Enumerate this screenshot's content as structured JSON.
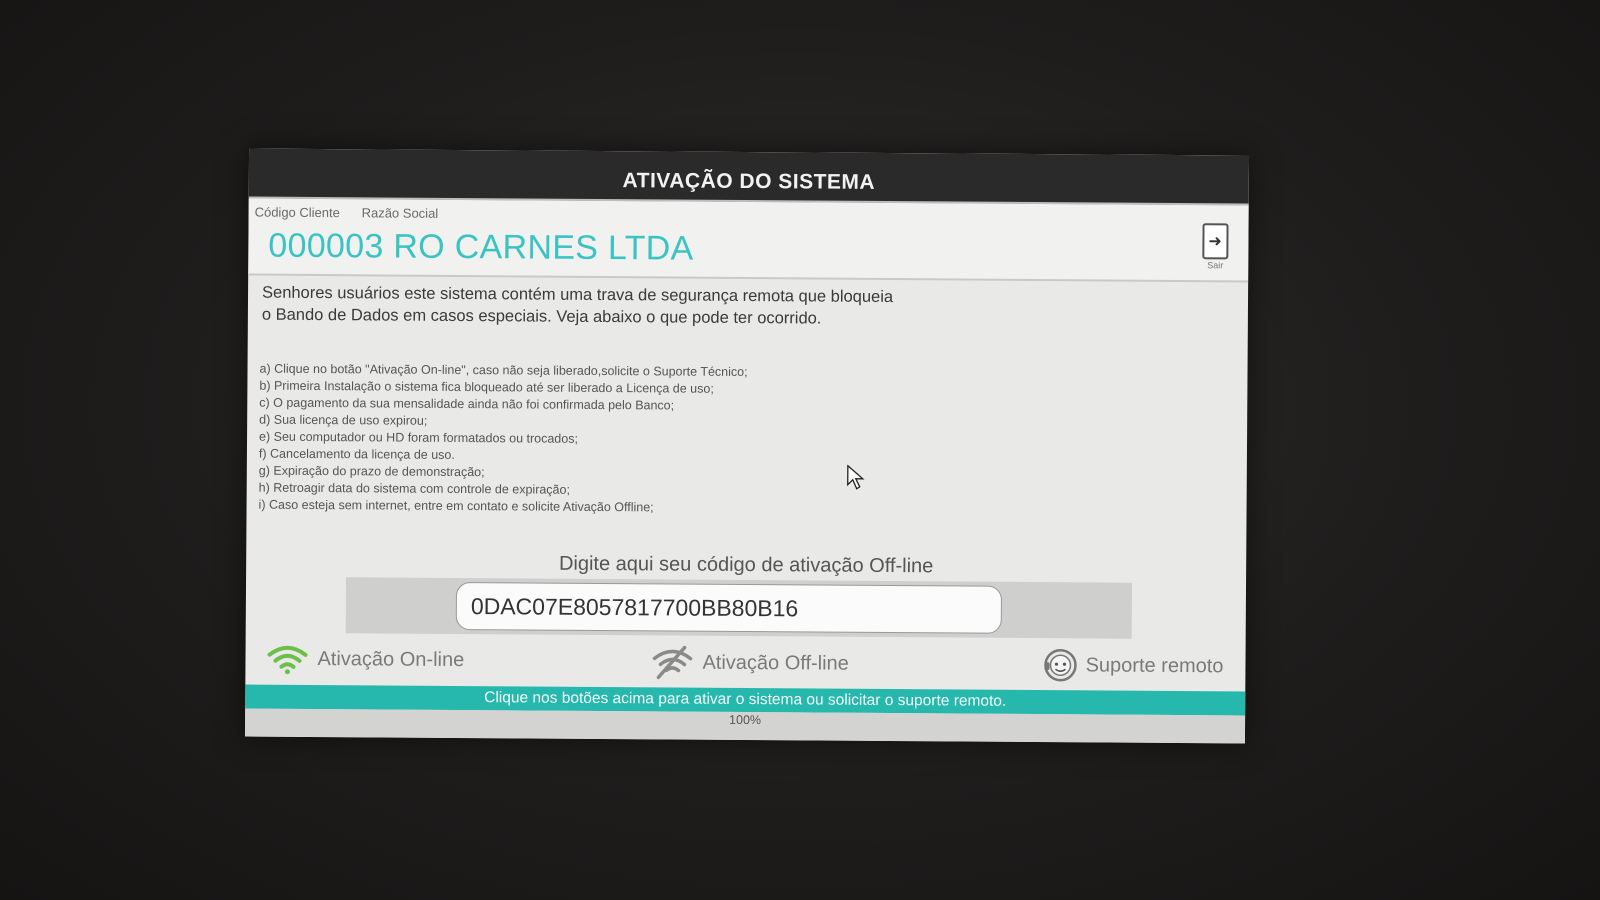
{
  "window": {
    "title": "ATIVAÇÃO DO SISTEMA"
  },
  "client": {
    "code_label": "Código Cliente",
    "company_label": "Razão Social",
    "display_name": "000003 RO CARNES LTDA"
  },
  "exit_button": {
    "label": "Sair",
    "icon": "exit-door-icon"
  },
  "intro": {
    "line1": "Senhores usuários este sistema contém uma trava de segurança remota que bloqueia",
    "line2": "o Bando de Dados em casos especiais. Veja abaixo o que pode ter ocorrido."
  },
  "reasons": [
    "a) Clique no botão \"Ativação On-line\", caso não seja liberado,solicite o Suporte Técnico;",
    "b) Primeira Instalação o sistema fica bloqueado até ser liberado a Licença de uso;",
    "c) O pagamento da sua mensalidade ainda não foi confirmada pelo Banco;",
    "d) Sua licença de uso expirou;",
    "e) Seu computador ou HD foram formatados ou trocados;",
    "f) Cancelamento da licença de uso.",
    "g) Expiração do prazo de demonstração;",
    "h) Retroagir data do sistema com controle de expiração;",
    "i) Caso esteja sem internet, entre em contato e solicite Ativação Offline;"
  ],
  "activation": {
    "prompt": "Digite aqui seu código de ativação Off-line",
    "code_value": "0DAC07E8057817700BB80B16"
  },
  "actions": {
    "online_label": "Ativação On-line",
    "offline_label": "Ativação Off-line",
    "remote_label": "Suporte remoto"
  },
  "status": {
    "message": "Clique nos botões acima para ativar o sistema ou solicitar o suporte remoto.",
    "progress_text": "100%",
    "progress_value": 1.0
  },
  "colors": {
    "accent": "#3ac3c3",
    "status_bar": "#27b8ad",
    "title_bar": "#2a2a2a",
    "online_icon": "#6cc04a"
  }
}
